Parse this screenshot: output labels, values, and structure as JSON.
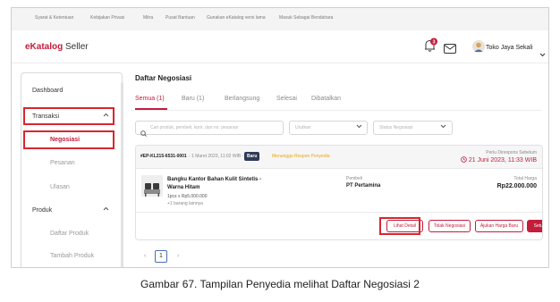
{
  "topbar": {
    "links": [
      "Syarat & Ketentuan",
      "Kebijakan Privasi",
      "Mitra",
      "Pusat Bantuan",
      "Gunakan eKatalog versi lama",
      "Masuk Sebagai Bendahara"
    ]
  },
  "header": {
    "logo_brand": "eKatalog",
    "logo_suffix": "Seller",
    "notification_count": "3",
    "store_name": "Toko Jaya Sekali",
    "icons": [
      "bell-icon",
      "mail-icon",
      "avatar",
      "chevron-down-icon"
    ]
  },
  "sidebar": {
    "dashboard": "Dashboard",
    "transaksi": "Transaksi",
    "negosiasi": "Negosiasi",
    "pesanan": "Pesanan",
    "ulasan": "Ulasan",
    "produk": "Produk",
    "daftar_produk": "Daftar Produk",
    "tambah_produk": "Tambah Produk"
  },
  "main": {
    "title": "Daftar Negosiasi",
    "tabs": [
      {
        "label": "Semua (1)",
        "active": true
      },
      {
        "label": "Baru (1)",
        "active": false
      },
      {
        "label": "Berlangsung",
        "active": false
      },
      {
        "label": "Selesai",
        "active": false
      },
      {
        "label": "Dibatalkan",
        "active": false
      }
    ],
    "search_placeholder": "Cari produk, pembeli, kurir, dan no. pesanan",
    "sort_placeholder": "Urutkan",
    "status_placeholder": "Status Negosiasi"
  },
  "order": {
    "id": "#EP-KL215-6531-0001",
    "date": "- 1 Maret 2023, 11:02 WIB -",
    "badge": "Baru",
    "status": "Menunggu Respon Penyedia",
    "respond_label": "Perlu Direspons Sebelum",
    "respond_deadline": "21 Juni 2023, 11:33 WIB",
    "product_name_line1": "Bangku Kantor Bahan Kulit Sintetis -",
    "product_name_line2": "Warna Hitam",
    "qty_price": "1pcs x Rp5.000.000",
    "more_items": "+1 barang lainnya",
    "buyer_label": "Pembeli",
    "buyer_name": "PT Pertamina",
    "total_label": "Total Harga",
    "total_value": "Rp22.000.000",
    "buttons": {
      "detail": "Lihat Detail",
      "reject": "Tolak Negosiasi",
      "propose": "Ajukan Harga Baru",
      "approve": "Setujui Negosiasi"
    }
  },
  "pagination": {
    "prev": "‹",
    "current": "1",
    "next": "›"
  },
  "caption": "Gambar 67. Tampilan Penyedia melihat Daftar Negosiasi 2",
  "colors": {
    "brand_red": "#c41c3b",
    "highlight_red": "#d9262e",
    "status_orange": "#e8a317",
    "badge_navy": "#2f3a56"
  }
}
